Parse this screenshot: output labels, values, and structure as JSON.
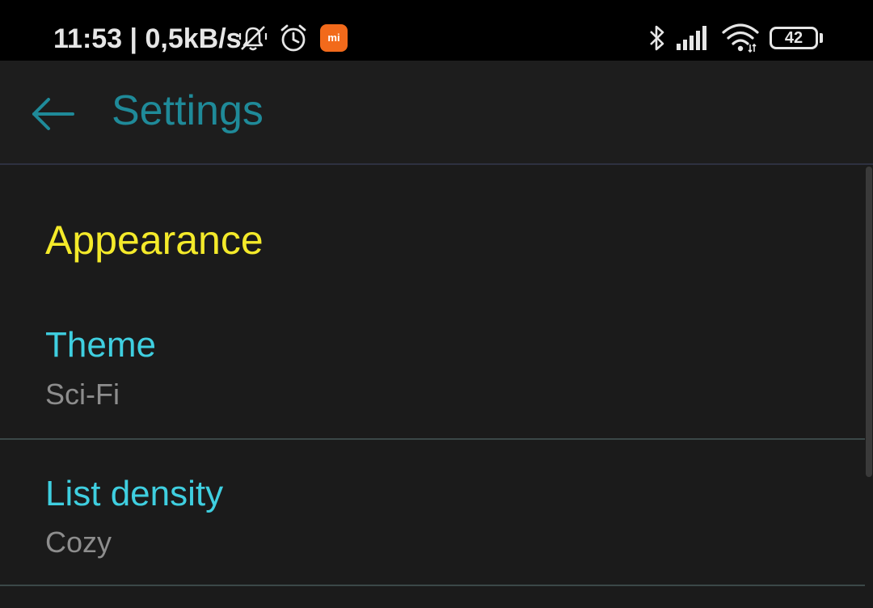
{
  "status_bar": {
    "time_speed": "11:53 | 0,5kB/s",
    "mi_badge": "mi",
    "battery_level": "42",
    "icons": [
      "vibrate-off-icon",
      "alarm-icon",
      "mi-app-icon",
      "bluetooth-icon",
      "cellular-signal-icon",
      "wifi-icon",
      "battery-icon"
    ]
  },
  "app_bar": {
    "title": "Settings",
    "back_icon": "arrow-back-icon"
  },
  "sections": [
    {
      "header": "Appearance",
      "items": [
        {
          "title": "Theme",
          "summary": "Sci-Fi"
        },
        {
          "title": "List density",
          "summary": "Cozy"
        }
      ]
    }
  ],
  "colors": {
    "background": "#1b1b1b",
    "status_bar": "#000000",
    "title": "#1f8a99",
    "section_header": "#f4ea2a",
    "item_title": "#3fcfe0",
    "item_summary": "#8d8d8d",
    "mi_orange": "#f26a1b"
  }
}
